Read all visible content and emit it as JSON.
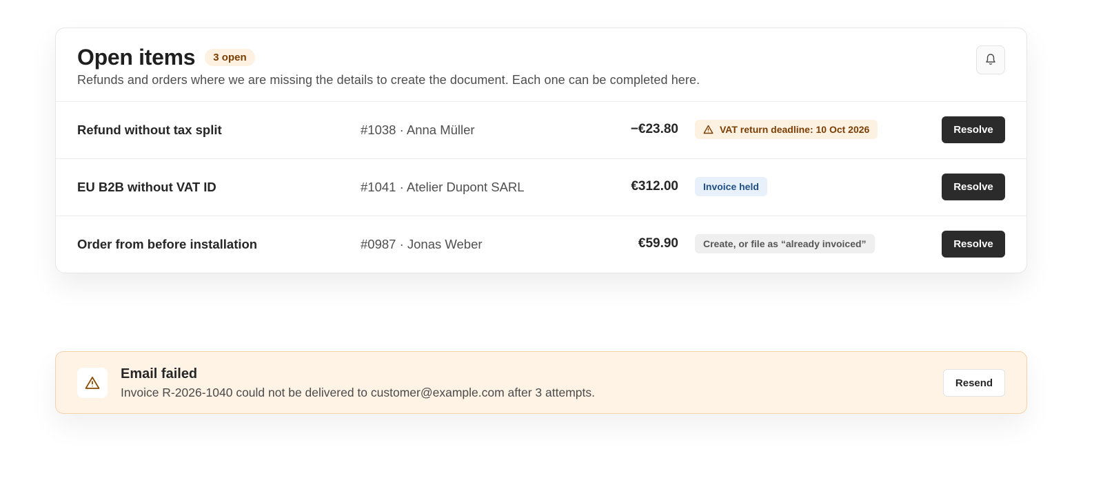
{
  "header": {
    "title": "Open items",
    "count_badge": "3 open",
    "subtitle": "Refunds and orders where we are missing the details to create the document. Each one can be completed here.",
    "bell_icon": "bell-icon"
  },
  "items": [
    {
      "title": "Refund without tax split",
      "meta": "#1038 · Anna Müller",
      "amount": "−€23.80",
      "tag": "VAT return deadline: 10 Oct 2026",
      "tag_variant": "warn",
      "tag_icon": "warning-icon",
      "action": "Resolve"
    },
    {
      "title": "EU B2B without VAT ID",
      "meta": "#1041 · Atelier Dupont SARL",
      "amount": "€312.00",
      "tag": "Invoice held",
      "tag_variant": "info",
      "action": "Resolve"
    },
    {
      "title": "Order from before installation",
      "meta": "#0987 · Jonas Weber",
      "amount": "€59.90",
      "tag": "Create, or file as “already invoiced”",
      "tag_variant": "neutral",
      "action": "Resolve"
    }
  ],
  "alert": {
    "icon": "warning-icon",
    "title": "Email failed",
    "text": "Invoice R-2026-1040 could not be delivered to customer@example.com after 3 attempts.",
    "action": "Resend"
  },
  "colors": {
    "primary_button": "#2b2b2b",
    "warn_bg": "#fdf1e2",
    "warn_text": "#7a3d00",
    "info_bg": "#e8f1fb",
    "info_text": "#1d4f86",
    "neutral_bg": "#efefef",
    "alert_bg": "#fff3e6"
  }
}
